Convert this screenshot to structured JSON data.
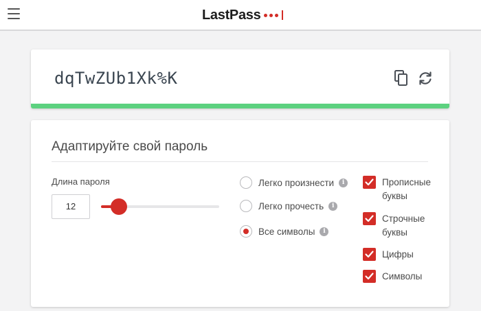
{
  "header": {
    "logo_text": "LastPass",
    "menu_icon": "hamburger-menu-icon",
    "brand_color": "#d32d27"
  },
  "generator": {
    "password": "dqTwZUb1Xk%K",
    "copy_icon": "copy-icon",
    "refresh_icon": "refresh-icon",
    "strength_color": "#5cd17f"
  },
  "options": {
    "title": "Адаптируйте свой пароль",
    "length_label": "Длина пароля",
    "length_value": "12",
    "length_min": 4,
    "length_max": 99,
    "radios": [
      {
        "label": "Легко произнести",
        "selected": false
      },
      {
        "label": "Легко прочесть",
        "selected": false
      },
      {
        "label": "Все символы",
        "selected": true
      }
    ],
    "checkboxes": [
      {
        "label": "Прописные буквы",
        "checked": true
      },
      {
        "label": "Строчные буквы",
        "checked": true
      },
      {
        "label": "Цифры",
        "checked": true
      },
      {
        "label": "Символы",
        "checked": true
      }
    ]
  }
}
